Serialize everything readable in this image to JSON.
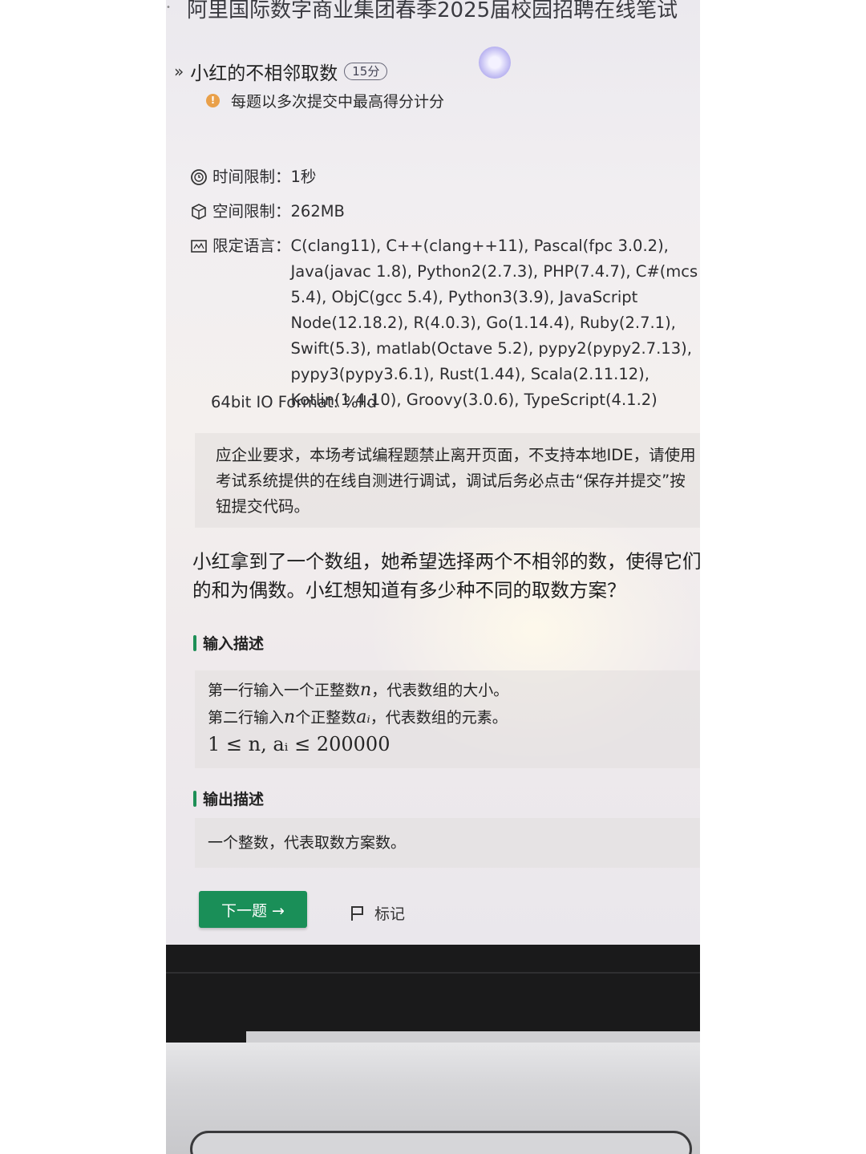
{
  "exam": {
    "title": "阿里国际数字商业集团春季2025届校园招聘在线笔试"
  },
  "question": {
    "title": "小红的不相邻取数",
    "score": "15分",
    "notice": "每题以多次提交中最高得分计分"
  },
  "limits": {
    "time_label": "时间限制：",
    "time_value": "1秒",
    "space_label": "空间限制：",
    "space_value": "262MB",
    "language_label": "限定语言：",
    "language_value": "C(clang11), C++(clang++11), Pascal(fpc 3.0.2), Java(javac 1.8), Python2(2.7.3), PHP(7.4.7), C#(mcs 5.4), ObjC(gcc 5.4), Python3(3.9), JavaScript Node(12.18.2), R(4.0.3), Go(1.14.4), Ruby(2.7.1), Swift(5.3), matlab(Octave 5.2), pypy2(pypy2.7.13), pypy3(pypy3.6.1), Rust(1.44), Scala(2.11.12), Kotlin(1.4.10), Groovy(3.0.6), TypeScript(4.1.2)",
    "io_format": "64bit IO Format: %lld"
  },
  "exam_notice": "应企业要求，本场考试编程题禁止离开页面，不支持本地IDE，请使用考试系统提供的在线自测进行调试，调试后务必点击“保存并提交”按钮提交代码。",
  "statement": "小红拿到了一个数组，她希望选择两个不相邻的数，使得它们的和为偶数。小红想知道有多少种不同的取数方案？",
  "input": {
    "heading": "输入描述",
    "line1_prefix": "第一行输入一个正整数",
    "line1_var": "n",
    "line1_suffix": "，代表数组的大小。",
    "line2_prefix": "第二行输入",
    "line2_var": "n",
    "line2_mid": "个正整数",
    "line2_var2": "aᵢ",
    "line2_suffix": "，代表数组的元素。",
    "constraint": "1 ≤ n, aᵢ ≤ 200000"
  },
  "output": {
    "heading": "输出描述",
    "text": "一个整数，代表取数方案数。"
  },
  "actions": {
    "next_label": "下一题 →",
    "mark_label": "标记"
  },
  "colors": {
    "accent_green": "#1a8f58",
    "warning_orange": "#e9a04a"
  },
  "icons": [
    "collapse-icon",
    "warning-icon",
    "clock-icon",
    "box-icon",
    "code-icon",
    "flag-icon"
  ]
}
